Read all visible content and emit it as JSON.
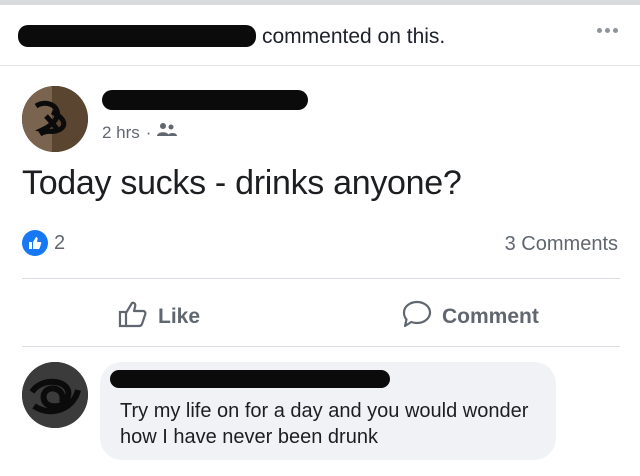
{
  "header": {
    "action_text": "commented on this."
  },
  "post": {
    "time": "2 hrs",
    "separator": "·",
    "text": "Today sucks - drinks anyone?",
    "like_count": "2",
    "comments_count": "3 Comments"
  },
  "actions": {
    "like_label": "Like",
    "comment_label": "Comment"
  },
  "comment": {
    "text": "Try my life on for a day and you would wonder how I have never been drunk"
  },
  "colors": {
    "accent": "#1877f2",
    "muted": "#606770",
    "bubble": "#f0f2f5"
  },
  "icons": [
    "more-icon",
    "friends-icon",
    "like-badge-icon",
    "thumbs-up-icon",
    "comment-icon"
  ]
}
